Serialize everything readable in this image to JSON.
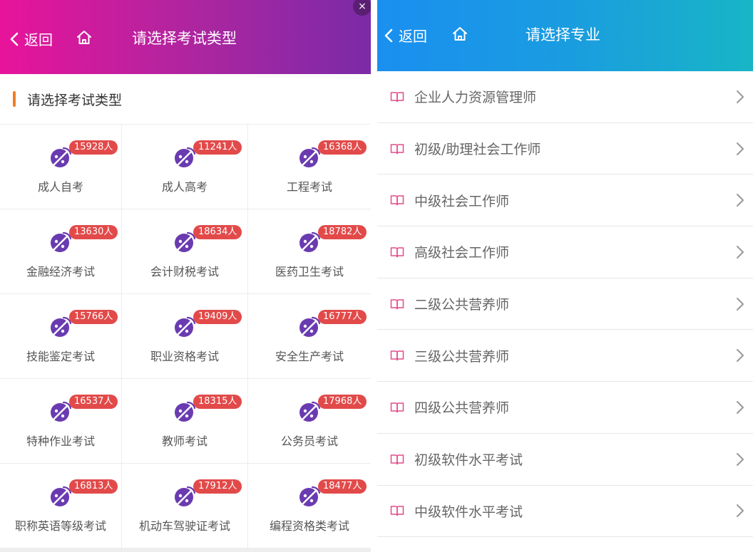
{
  "left": {
    "header": {
      "back_label": "返回",
      "title": "请选择考试类型"
    },
    "close_label": "×",
    "section_title": "请选择考试类型",
    "exams": [
      {
        "label": "成人自考",
        "count": "15928人"
      },
      {
        "label": "成人高考",
        "count": "11241人"
      },
      {
        "label": "工程考试",
        "count": "16368人"
      },
      {
        "label": "金融经济考试",
        "count": "13630人"
      },
      {
        "label": "会计财税考试",
        "count": "18634人"
      },
      {
        "label": "医药卫生考试",
        "count": "18782人"
      },
      {
        "label": "技能鉴定考试",
        "count": "15766人"
      },
      {
        "label": "职业资格考试",
        "count": "19409人"
      },
      {
        "label": "安全生产考试",
        "count": "16777人"
      },
      {
        "label": "特种作业考试",
        "count": "16537人"
      },
      {
        "label": "教师考试",
        "count": "18315人"
      },
      {
        "label": "公务员考试",
        "count": "17968人"
      },
      {
        "label": "职称英语等级考试",
        "count": "16813人"
      },
      {
        "label": "机动车驾驶证考试",
        "count": "17912人"
      },
      {
        "label": "编程资格类考试",
        "count": "18477人"
      }
    ]
  },
  "right": {
    "header": {
      "back_label": "返回",
      "title": "请选择专业"
    },
    "majors": [
      "企业人力资源管理师",
      "初级/助理社会工作师",
      "中级社会工作师",
      "高级社会工作师",
      "二级公共营养师",
      "三级公共营养师",
      "四级公共营养师",
      "初级软件水平考试",
      "中级软件水平考试"
    ]
  },
  "colors": {
    "left_header_start": "#e8139b",
    "left_header_end": "#7b2aa8",
    "right_header_start": "#1a8ff0",
    "right_header_end": "#18b5c6",
    "badge": "#e24a4a",
    "icon": "#6a3bb0",
    "section_accent": "#f07d21",
    "book_icon": "#e24a8a"
  }
}
